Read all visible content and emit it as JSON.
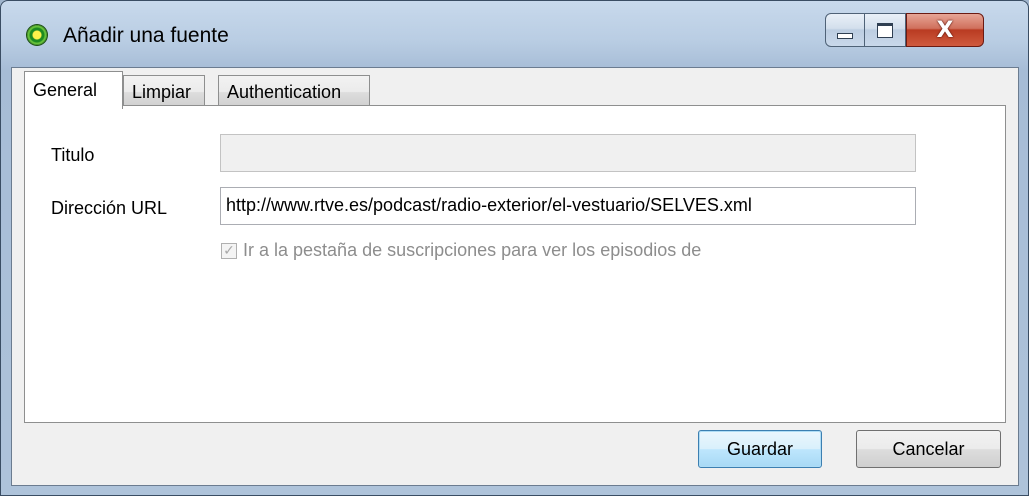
{
  "window": {
    "title": "Añadir una fuente",
    "close_symbol": "X"
  },
  "tabs": [
    {
      "label": "General",
      "active": true
    },
    {
      "label": "Limpiar",
      "active": false
    },
    {
      "label": "Authentication",
      "active": false
    }
  ],
  "form": {
    "title_label": "Titulo",
    "title_value": "",
    "url_label": "Dirección URL",
    "url_value": "http://www.rtve.es/podcast/radio-exterior/el-vestuario/SELVES.xml",
    "checkbox_label": "Ir a la pestaña de suscripciones para ver los episodios de",
    "checkbox_checked": true,
    "checkbox_enabled": false
  },
  "buttons": {
    "save_label": "Guardar",
    "cancel_label": "Cancelar"
  },
  "icons": {
    "app": "green-circle-app-icon",
    "minimize": "minimize-icon",
    "maximize": "maximize-icon",
    "close": "close-icon",
    "check": "checkmark-icon"
  },
  "colors": {
    "close_button": "#c0442b",
    "default_button": "#bee6fd"
  }
}
